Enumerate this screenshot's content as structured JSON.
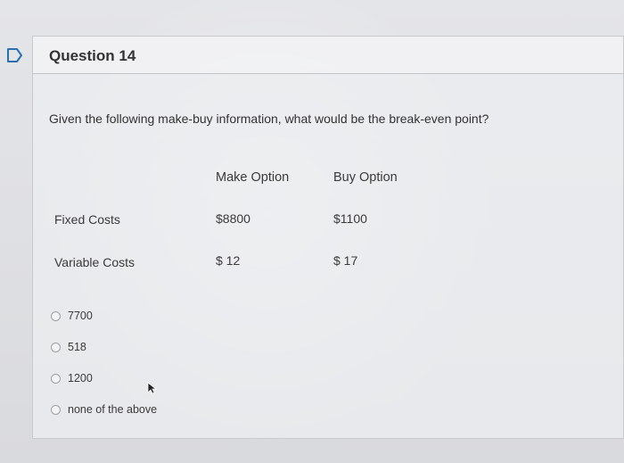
{
  "question": {
    "title": "Question 14",
    "prompt": "Given the following make-buy information, what would be the break-even point?"
  },
  "table": {
    "headers": [
      "Make Option",
      "Buy Option"
    ],
    "rows": [
      {
        "label": "Fixed Costs",
        "make": "$8800",
        "buy": "$1100"
      },
      {
        "label": "Variable Costs",
        "make": "$ 12",
        "buy": "$ 17"
      }
    ]
  },
  "options": [
    {
      "label": "7700"
    },
    {
      "label": "518"
    },
    {
      "label": "1200"
    },
    {
      "label": "none of the above"
    }
  ],
  "icons": {
    "flag": "flag-icon",
    "cursor": "cursor-arrow-icon"
  },
  "colors": {
    "flag": "#2a6fb0",
    "radio_border": "#9aa0a6"
  }
}
